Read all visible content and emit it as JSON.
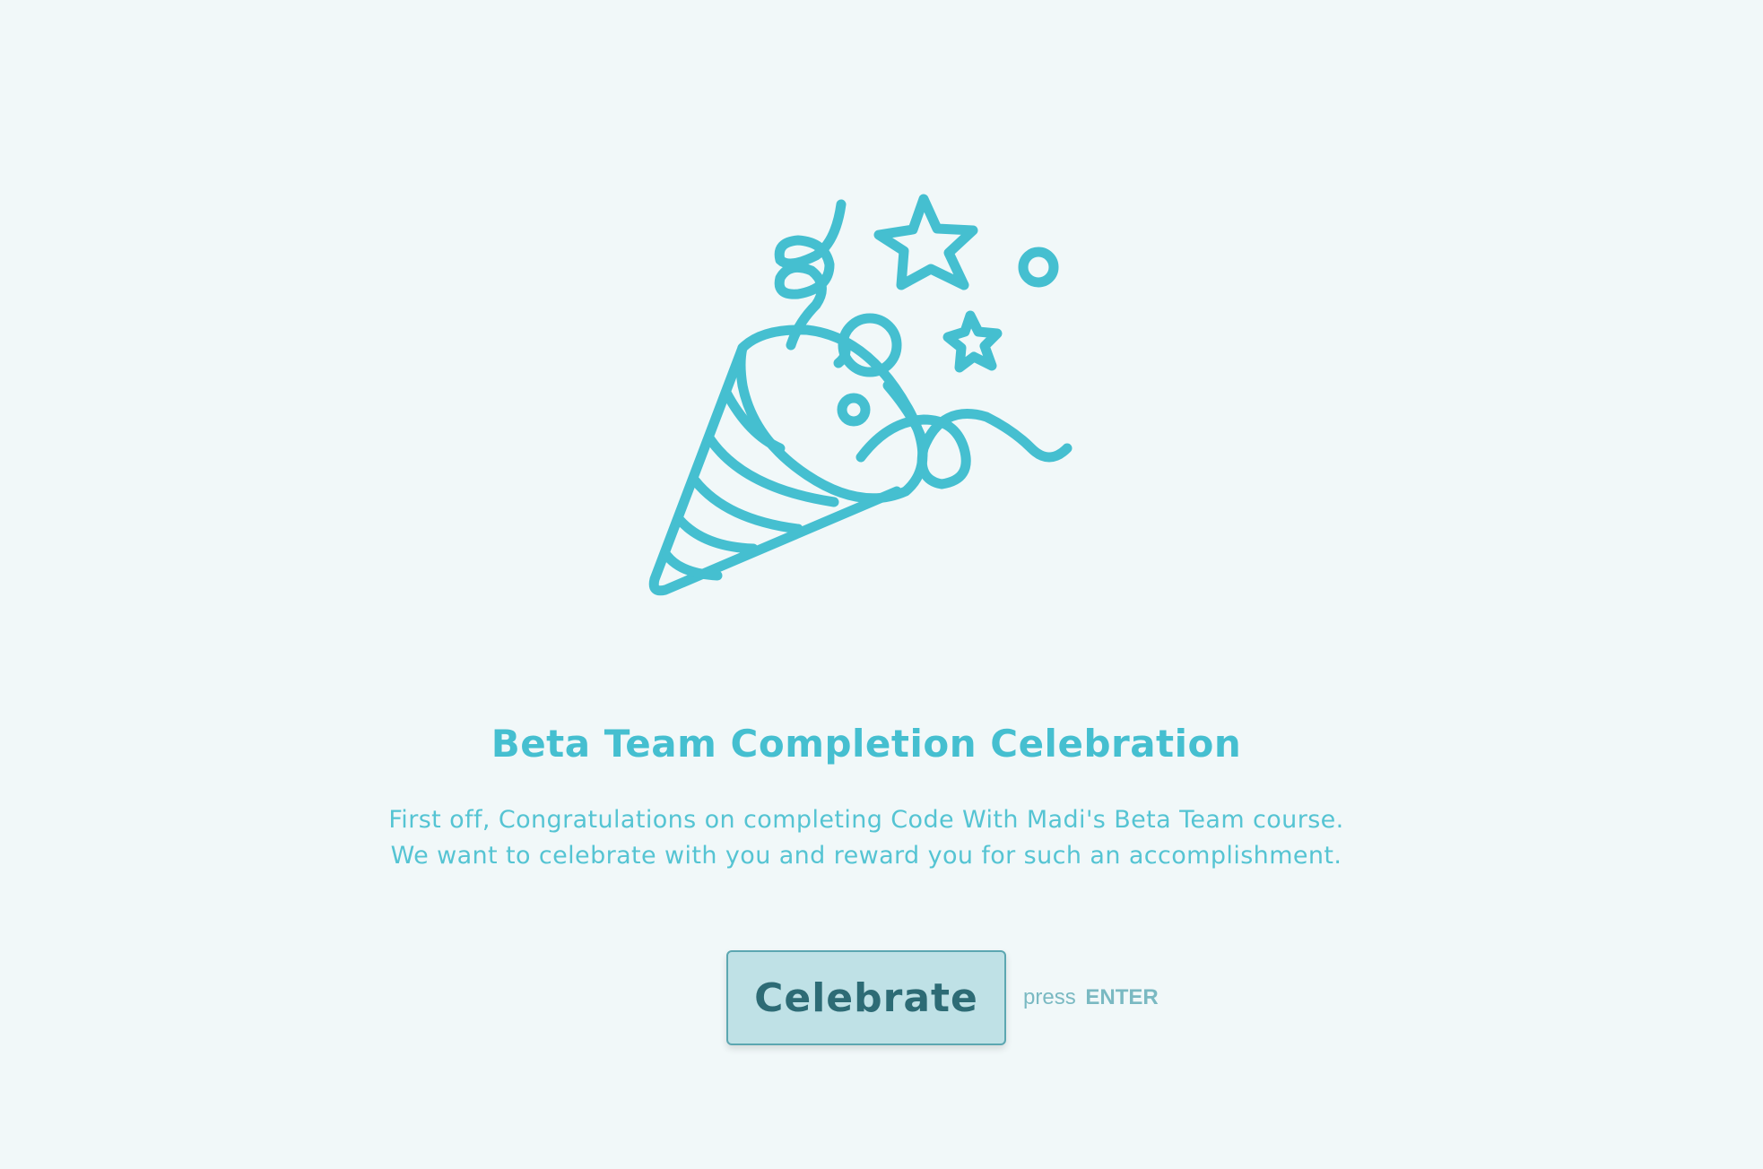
{
  "colors": {
    "background": "#f1f8f9",
    "accent": "#45bfd0",
    "button_fill": "#bfe1e6",
    "button_border": "#5ca7b1",
    "button_text": "#2d6b75",
    "hint_text": "#7ab9c2"
  },
  "illustration": {
    "icon": "party-popper-icon"
  },
  "heading": {
    "title": "Beta Team Completion Celebration"
  },
  "description": {
    "line1": "First off, Congratulations on completing Code With Madi's Beta Team course.",
    "line2": "We want to celebrate with you and reward you for such an accomplishment."
  },
  "actions": {
    "celebrate_label": "Celebrate",
    "hint_prefix": "press",
    "hint_key": "ENTER"
  }
}
